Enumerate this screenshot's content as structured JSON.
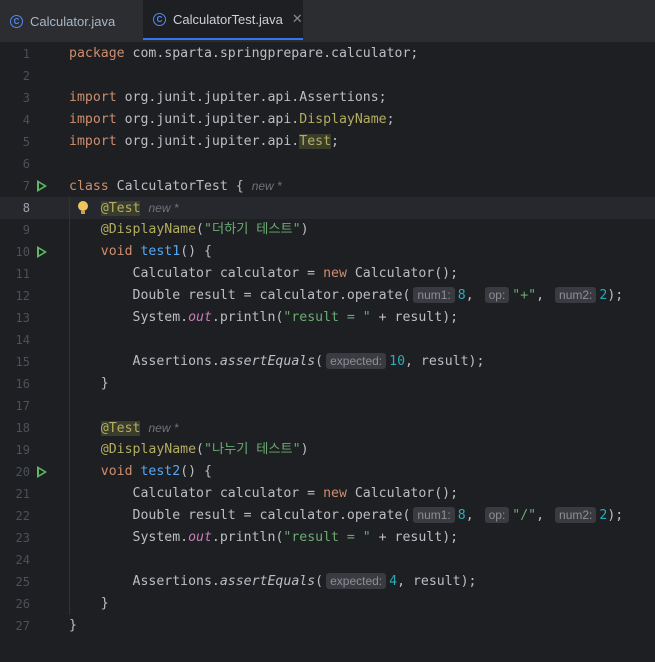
{
  "tabs": [
    {
      "label": "Calculator.java",
      "active": false
    },
    {
      "label": "CalculatorTest.java",
      "active": true
    }
  ],
  "editor": {
    "current_line": 8,
    "lines": [
      {
        "n": "1",
        "tokens": [
          {
            "c": "kw",
            "t": "package"
          },
          {
            "t": " com.sparta.springprepare.calculator;"
          }
        ]
      },
      {
        "n": "2",
        "tokens": []
      },
      {
        "n": "3",
        "tokens": [
          {
            "c": "kw",
            "t": "import"
          },
          {
            "t": " org.junit.jupiter.api.Assertions;"
          }
        ]
      },
      {
        "n": "4",
        "tokens": [
          {
            "c": "kw",
            "t": "import"
          },
          {
            "t": " org.junit.jupiter.api."
          },
          {
            "c": "an",
            "t": "DisplayName"
          },
          {
            "t": ";"
          }
        ]
      },
      {
        "n": "5",
        "tokens": [
          {
            "c": "kw",
            "t": "import"
          },
          {
            "t": " org.junit.jupiter.api."
          },
          {
            "c": "an hl",
            "t": "Test"
          },
          {
            "t": ";"
          }
        ]
      },
      {
        "n": "6",
        "tokens": []
      },
      {
        "n": "7",
        "run": true,
        "tokens": [
          {
            "c": "kw",
            "t": "class"
          },
          {
            "t": " CalculatorTest {"
          },
          {
            "c": "new",
            "t": "new *"
          }
        ]
      },
      {
        "n": "8",
        "bulb": true,
        "tokens": [
          {
            "t": "    "
          },
          {
            "c": "an hl",
            "t": "@Test"
          },
          {
            "c": "new",
            "t": "new *"
          }
        ]
      },
      {
        "n": "9",
        "tokens": [
          {
            "t": "    "
          },
          {
            "c": "an",
            "t": "@DisplayName"
          },
          {
            "t": "("
          },
          {
            "c": "st",
            "t": "\"더하기 테스트\""
          },
          {
            "t": ")"
          }
        ]
      },
      {
        "n": "10",
        "run": true,
        "tokens": [
          {
            "t": "    "
          },
          {
            "c": "kw",
            "t": "void"
          },
          {
            "t": " "
          },
          {
            "c": "fn",
            "t": "test1"
          },
          {
            "t": "() {"
          }
        ]
      },
      {
        "n": "11",
        "tokens": [
          {
            "t": "        Calculator calculator = "
          },
          {
            "c": "kw",
            "t": "new"
          },
          {
            "t": " Calculator();"
          }
        ]
      },
      {
        "n": "12",
        "tokens": [
          {
            "t": "        Double result = calculator.operate("
          },
          {
            "c": "hint",
            "t": "num1:"
          },
          {
            "c": "nu",
            "t": "8"
          },
          {
            "t": ", "
          },
          {
            "c": "hint",
            "t": "op:"
          },
          {
            "c": "st",
            "t": "\"+\""
          },
          {
            "t": ", "
          },
          {
            "c": "hint",
            "t": "num2:"
          },
          {
            "c": "nu",
            "t": "2"
          },
          {
            "t": ");"
          }
        ]
      },
      {
        "n": "13",
        "tokens": [
          {
            "t": "        System."
          },
          {
            "c": "fld",
            "t": "out"
          },
          {
            "t": ".println("
          },
          {
            "c": "st",
            "t": "\"result = \""
          },
          {
            "t": " + result);"
          }
        ]
      },
      {
        "n": "14",
        "tokens": []
      },
      {
        "n": "15",
        "tokens": [
          {
            "t": "        Assertions."
          },
          {
            "c": "it",
            "t": "assertEquals"
          },
          {
            "t": "("
          },
          {
            "c": "hint",
            "t": "expected:"
          },
          {
            "c": "nu",
            "t": "10"
          },
          {
            "t": ", result);"
          }
        ]
      },
      {
        "n": "16",
        "tokens": [
          {
            "t": "    }"
          }
        ]
      },
      {
        "n": "17",
        "tokens": []
      },
      {
        "n": "18",
        "tokens": [
          {
            "t": "    "
          },
          {
            "c": "an hl",
            "t": "@Test"
          },
          {
            "c": "new",
            "t": "new *"
          }
        ]
      },
      {
        "n": "19",
        "tokens": [
          {
            "t": "    "
          },
          {
            "c": "an",
            "t": "@DisplayName"
          },
          {
            "t": "("
          },
          {
            "c": "st",
            "t": "\"나누기 테스트\""
          },
          {
            "t": ")"
          }
        ]
      },
      {
        "n": "20",
        "run": true,
        "tokens": [
          {
            "t": "    "
          },
          {
            "c": "kw",
            "t": "void"
          },
          {
            "t": " "
          },
          {
            "c": "fn",
            "t": "test2"
          },
          {
            "t": "() {"
          }
        ]
      },
      {
        "n": "21",
        "tokens": [
          {
            "t": "        Calculator calculator = "
          },
          {
            "c": "kw",
            "t": "new"
          },
          {
            "t": " Calculator();"
          }
        ]
      },
      {
        "n": "22",
        "tokens": [
          {
            "t": "        Double result = calculator.operate("
          },
          {
            "c": "hint",
            "t": "num1:"
          },
          {
            "c": "nu",
            "t": "8"
          },
          {
            "t": ", "
          },
          {
            "c": "hint",
            "t": "op:"
          },
          {
            "c": "st",
            "t": "\"/\""
          },
          {
            "t": ", "
          },
          {
            "c": "hint",
            "t": "num2:"
          },
          {
            "c": "nu",
            "t": "2"
          },
          {
            "t": ");"
          }
        ]
      },
      {
        "n": "23",
        "tokens": [
          {
            "t": "        System."
          },
          {
            "c": "fld",
            "t": "out"
          },
          {
            "t": ".println("
          },
          {
            "c": "st",
            "t": "\"result = \""
          },
          {
            "t": " + result);"
          }
        ]
      },
      {
        "n": "24",
        "tokens": []
      },
      {
        "n": "25",
        "tokens": [
          {
            "t": "        Assertions."
          },
          {
            "c": "it",
            "t": "assertEquals"
          },
          {
            "t": "("
          },
          {
            "c": "hint",
            "t": "expected:"
          },
          {
            "c": "nu",
            "t": "4"
          },
          {
            "t": ", result);"
          }
        ]
      },
      {
        "n": "26",
        "tokens": [
          {
            "t": "    }"
          }
        ]
      },
      {
        "n": "27",
        "tokens": [
          {
            "t": "}"
          }
        ]
      }
    ]
  }
}
